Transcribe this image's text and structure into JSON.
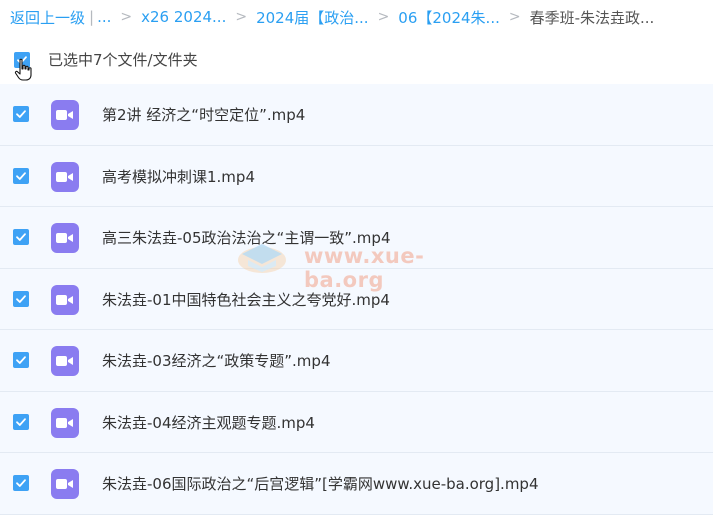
{
  "breadcrumb": {
    "back_label": "返回上一级",
    "bar": "|",
    "ellipsis": "...",
    "items": [
      "x26 2024...",
      "2024届【政治...",
      "06【2024朱...",
      "春季班-朱法垚政..."
    ]
  },
  "selection": {
    "status_text": "已选中7个文件/文件夹"
  },
  "files": [
    {
      "name": "第2讲 经济之“时空定位”.mp4"
    },
    {
      "name": "高考模拟冲刺课1.mp4"
    },
    {
      "name": "高三朱法垚-05政治法治之“主谓一致”.mp4"
    },
    {
      "name": "朱法垚-01中国特色社会主义之夸党好.mp4"
    },
    {
      "name": "朱法垚-03经济之“政策专题”.mp4"
    },
    {
      "name": "朱法垚-04经济主观题专题.mp4"
    },
    {
      "name": "朱法垚-06国际政治之“后宫逻辑”[学霸网www.xue-ba.org].mp4"
    }
  ],
  "watermark": {
    "text": "www.xue-ba.org"
  },
  "colors": {
    "link": "#2a9ff2",
    "checkbox": "#3ea2f5",
    "video_icon": "#8a7cf0",
    "row_bg": "#f5f9ff"
  }
}
